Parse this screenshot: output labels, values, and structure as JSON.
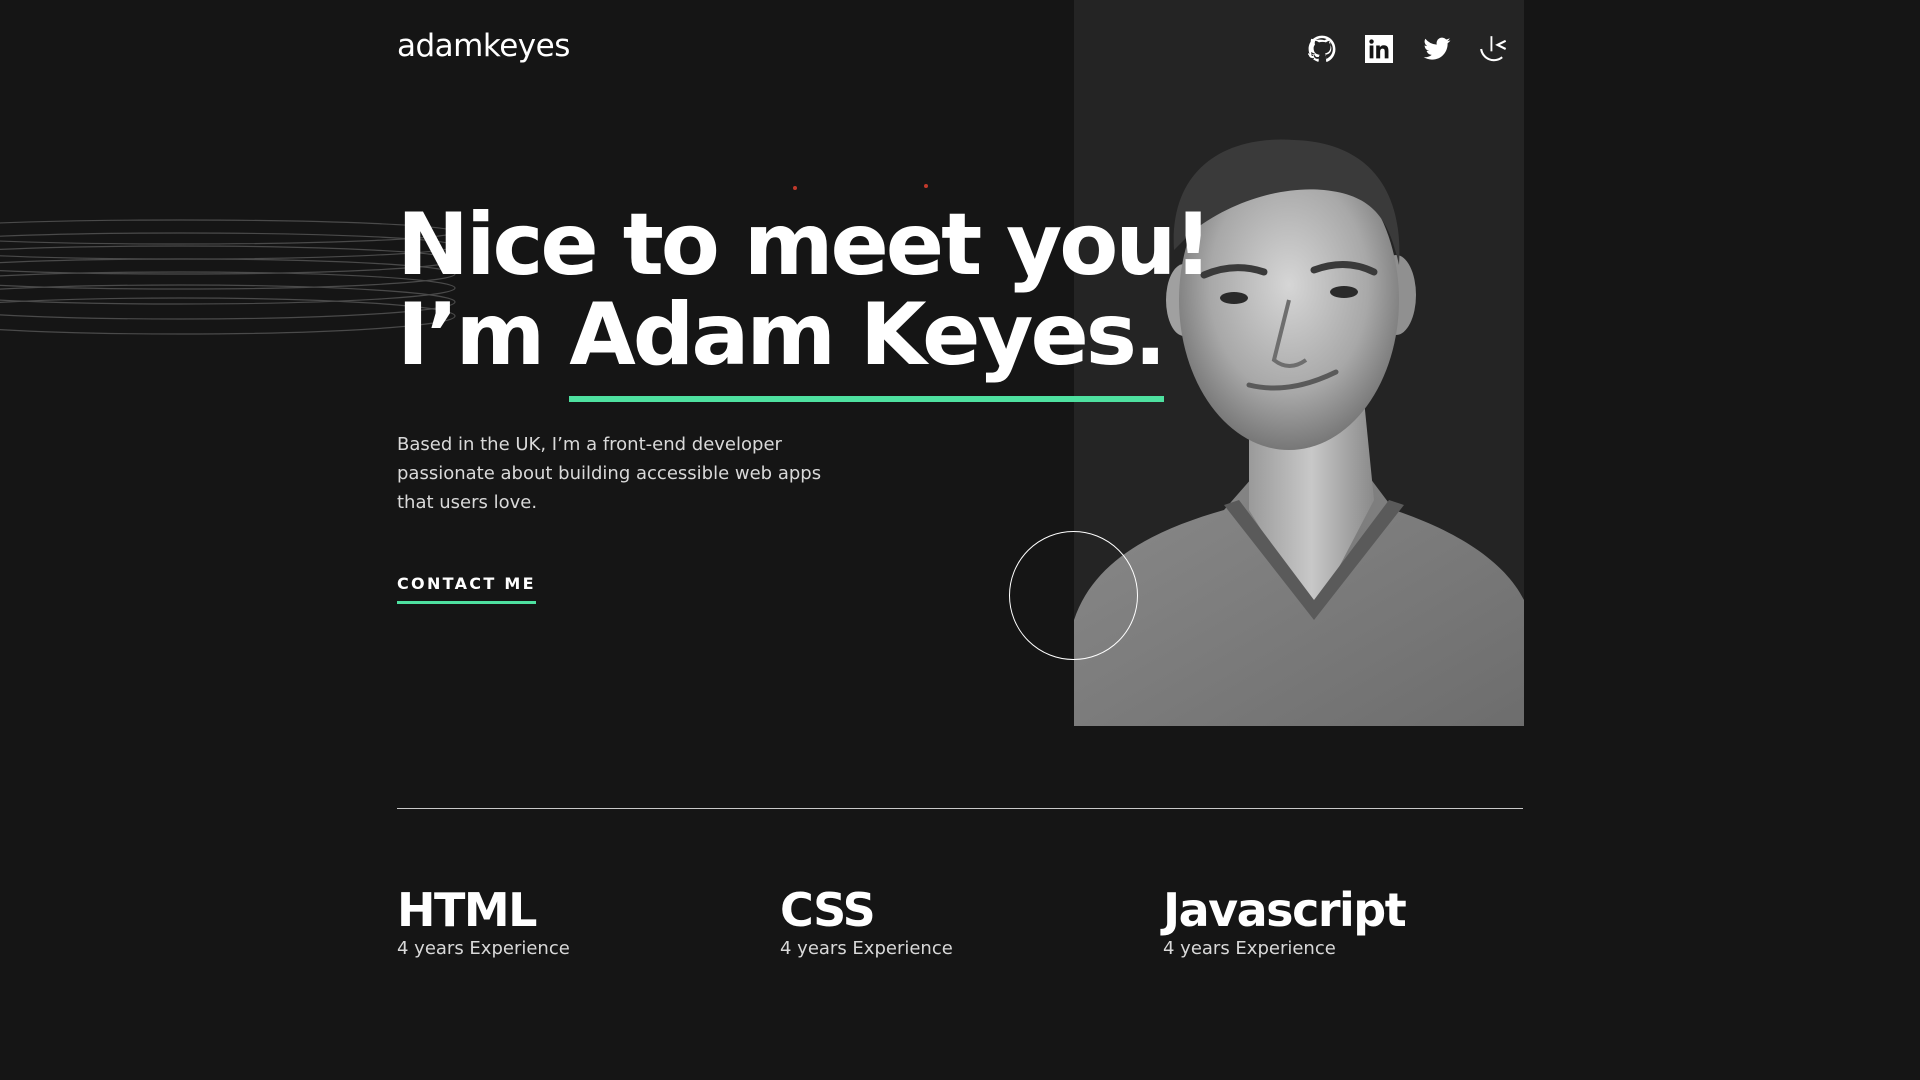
{
  "header": {
    "logo": "adamkeyes",
    "social": [
      {
        "icon": "github-icon",
        "label": "GitHub"
      },
      {
        "icon": "linkedin-icon",
        "label": "LinkedIn"
      },
      {
        "icon": "twitter-icon",
        "label": "Twitter"
      },
      {
        "icon": "frontend-mentor-icon",
        "label": "Frontend Mentor"
      }
    ]
  },
  "hero": {
    "line1": "Nice to meet you!",
    "line2_prefix": "I’m ",
    "name": "Adam Keyes.",
    "intro": "Based in the UK, I’m a front-end developer passionate about building accessible web apps that users love.",
    "cta": "CONTACT ME"
  },
  "skills": [
    {
      "name": "HTML",
      "experience": "4 years Experience"
    },
    {
      "name": "CSS",
      "experience": "4 years Experience"
    },
    {
      "name": "Javascript",
      "experience": "4 years Experience"
    }
  ],
  "colors": {
    "background": "#151515",
    "accent": "#4ee1a0",
    "panel": "#242424"
  }
}
